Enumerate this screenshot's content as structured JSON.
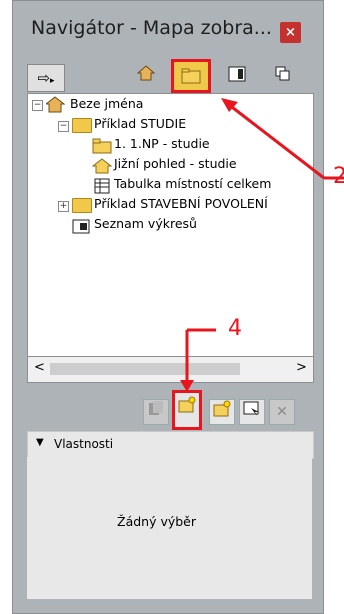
{
  "window": {
    "title": "Navigátor - Mapa zobra...",
    "close_label": "×"
  },
  "toolbar": {
    "menu_glyph": "⇨",
    "views": [
      "house-icon",
      "folder-open-icon",
      "layout-icon",
      "copy-icon"
    ]
  },
  "tree": {
    "root": "Beze jména",
    "items": [
      {
        "label": "Příklad STUDIE"
      },
      {
        "label": "1. 1.NP - studie"
      },
      {
        "label": "Jižní pohled - studie"
      },
      {
        "label": "Tabulka místností celkem"
      },
      {
        "label": "Příklad STAVEBNÍ POVOLENÍ"
      },
      {
        "label": "Seznam výkresů"
      }
    ]
  },
  "scroll": {
    "left": "<",
    "right": ">"
  },
  "bottom_toolbar": {
    "delete_glyph": "✕"
  },
  "properties": {
    "header": "Vlastnosti",
    "empty_text": "Žádný výběr"
  },
  "annotations": {
    "label_2": "2",
    "label_4": "4"
  },
  "colors": {
    "accent_red": "#e8141e",
    "panel_gray": "#aeb3b8"
  }
}
